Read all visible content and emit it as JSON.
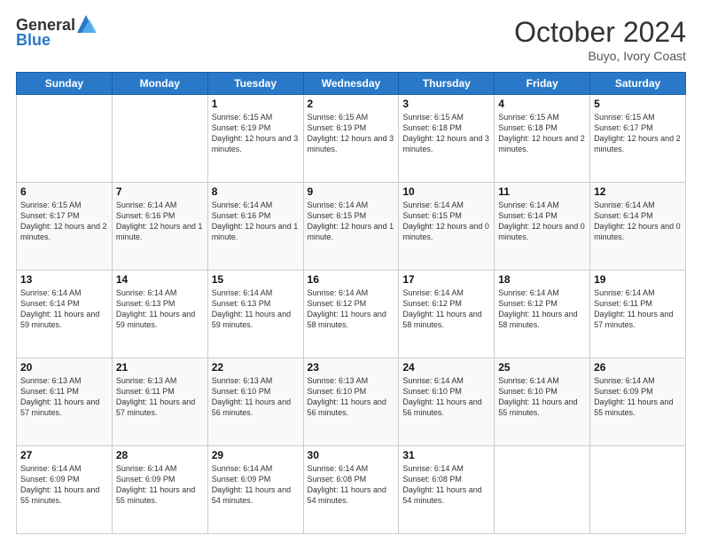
{
  "header": {
    "logo_line1": "General",
    "logo_line2": "Blue",
    "month_title": "October 2024",
    "subtitle": "Buyo, Ivory Coast"
  },
  "days_of_week": [
    "Sunday",
    "Monday",
    "Tuesday",
    "Wednesday",
    "Thursday",
    "Friday",
    "Saturday"
  ],
  "weeks": [
    [
      {
        "day": "",
        "sunrise": "",
        "sunset": "",
        "daylight": ""
      },
      {
        "day": "",
        "sunrise": "",
        "sunset": "",
        "daylight": ""
      },
      {
        "day": "1",
        "sunrise": "Sunrise: 6:15 AM",
        "sunset": "Sunset: 6:19 PM",
        "daylight": "Daylight: 12 hours and 3 minutes."
      },
      {
        "day": "2",
        "sunrise": "Sunrise: 6:15 AM",
        "sunset": "Sunset: 6:19 PM",
        "daylight": "Daylight: 12 hours and 3 minutes."
      },
      {
        "day": "3",
        "sunrise": "Sunrise: 6:15 AM",
        "sunset": "Sunset: 6:18 PM",
        "daylight": "Daylight: 12 hours and 3 minutes."
      },
      {
        "day": "4",
        "sunrise": "Sunrise: 6:15 AM",
        "sunset": "Sunset: 6:18 PM",
        "daylight": "Daylight: 12 hours and 2 minutes."
      },
      {
        "day": "5",
        "sunrise": "Sunrise: 6:15 AM",
        "sunset": "Sunset: 6:17 PM",
        "daylight": "Daylight: 12 hours and 2 minutes."
      }
    ],
    [
      {
        "day": "6",
        "sunrise": "Sunrise: 6:15 AM",
        "sunset": "Sunset: 6:17 PM",
        "daylight": "Daylight: 12 hours and 2 minutes."
      },
      {
        "day": "7",
        "sunrise": "Sunrise: 6:14 AM",
        "sunset": "Sunset: 6:16 PM",
        "daylight": "Daylight: 12 hours and 1 minute."
      },
      {
        "day": "8",
        "sunrise": "Sunrise: 6:14 AM",
        "sunset": "Sunset: 6:16 PM",
        "daylight": "Daylight: 12 hours and 1 minute."
      },
      {
        "day": "9",
        "sunrise": "Sunrise: 6:14 AM",
        "sunset": "Sunset: 6:15 PM",
        "daylight": "Daylight: 12 hours and 1 minute."
      },
      {
        "day": "10",
        "sunrise": "Sunrise: 6:14 AM",
        "sunset": "Sunset: 6:15 PM",
        "daylight": "Daylight: 12 hours and 0 minutes."
      },
      {
        "day": "11",
        "sunrise": "Sunrise: 6:14 AM",
        "sunset": "Sunset: 6:14 PM",
        "daylight": "Daylight: 12 hours and 0 minutes."
      },
      {
        "day": "12",
        "sunrise": "Sunrise: 6:14 AM",
        "sunset": "Sunset: 6:14 PM",
        "daylight": "Daylight: 12 hours and 0 minutes."
      }
    ],
    [
      {
        "day": "13",
        "sunrise": "Sunrise: 6:14 AM",
        "sunset": "Sunset: 6:14 PM",
        "daylight": "Daylight: 11 hours and 59 minutes."
      },
      {
        "day": "14",
        "sunrise": "Sunrise: 6:14 AM",
        "sunset": "Sunset: 6:13 PM",
        "daylight": "Daylight: 11 hours and 59 minutes."
      },
      {
        "day": "15",
        "sunrise": "Sunrise: 6:14 AM",
        "sunset": "Sunset: 6:13 PM",
        "daylight": "Daylight: 11 hours and 59 minutes."
      },
      {
        "day": "16",
        "sunrise": "Sunrise: 6:14 AM",
        "sunset": "Sunset: 6:12 PM",
        "daylight": "Daylight: 11 hours and 58 minutes."
      },
      {
        "day": "17",
        "sunrise": "Sunrise: 6:14 AM",
        "sunset": "Sunset: 6:12 PM",
        "daylight": "Daylight: 11 hours and 58 minutes."
      },
      {
        "day": "18",
        "sunrise": "Sunrise: 6:14 AM",
        "sunset": "Sunset: 6:12 PM",
        "daylight": "Daylight: 11 hours and 58 minutes."
      },
      {
        "day": "19",
        "sunrise": "Sunrise: 6:14 AM",
        "sunset": "Sunset: 6:11 PM",
        "daylight": "Daylight: 11 hours and 57 minutes."
      }
    ],
    [
      {
        "day": "20",
        "sunrise": "Sunrise: 6:13 AM",
        "sunset": "Sunset: 6:11 PM",
        "daylight": "Daylight: 11 hours and 57 minutes."
      },
      {
        "day": "21",
        "sunrise": "Sunrise: 6:13 AM",
        "sunset": "Sunset: 6:11 PM",
        "daylight": "Daylight: 11 hours and 57 minutes."
      },
      {
        "day": "22",
        "sunrise": "Sunrise: 6:13 AM",
        "sunset": "Sunset: 6:10 PM",
        "daylight": "Daylight: 11 hours and 56 minutes."
      },
      {
        "day": "23",
        "sunrise": "Sunrise: 6:13 AM",
        "sunset": "Sunset: 6:10 PM",
        "daylight": "Daylight: 11 hours and 56 minutes."
      },
      {
        "day": "24",
        "sunrise": "Sunrise: 6:14 AM",
        "sunset": "Sunset: 6:10 PM",
        "daylight": "Daylight: 11 hours and 56 minutes."
      },
      {
        "day": "25",
        "sunrise": "Sunrise: 6:14 AM",
        "sunset": "Sunset: 6:10 PM",
        "daylight": "Daylight: 11 hours and 55 minutes."
      },
      {
        "day": "26",
        "sunrise": "Sunrise: 6:14 AM",
        "sunset": "Sunset: 6:09 PM",
        "daylight": "Daylight: 11 hours and 55 minutes."
      }
    ],
    [
      {
        "day": "27",
        "sunrise": "Sunrise: 6:14 AM",
        "sunset": "Sunset: 6:09 PM",
        "daylight": "Daylight: 11 hours and 55 minutes."
      },
      {
        "day": "28",
        "sunrise": "Sunrise: 6:14 AM",
        "sunset": "Sunset: 6:09 PM",
        "daylight": "Daylight: 11 hours and 55 minutes."
      },
      {
        "day": "29",
        "sunrise": "Sunrise: 6:14 AM",
        "sunset": "Sunset: 6:09 PM",
        "daylight": "Daylight: 11 hours and 54 minutes."
      },
      {
        "day": "30",
        "sunrise": "Sunrise: 6:14 AM",
        "sunset": "Sunset: 6:08 PM",
        "daylight": "Daylight: 11 hours and 54 minutes."
      },
      {
        "day": "31",
        "sunrise": "Sunrise: 6:14 AM",
        "sunset": "Sunset: 6:08 PM",
        "daylight": "Daylight: 11 hours and 54 minutes."
      },
      {
        "day": "",
        "sunrise": "",
        "sunset": "",
        "daylight": ""
      },
      {
        "day": "",
        "sunrise": "",
        "sunset": "",
        "daylight": ""
      }
    ]
  ]
}
